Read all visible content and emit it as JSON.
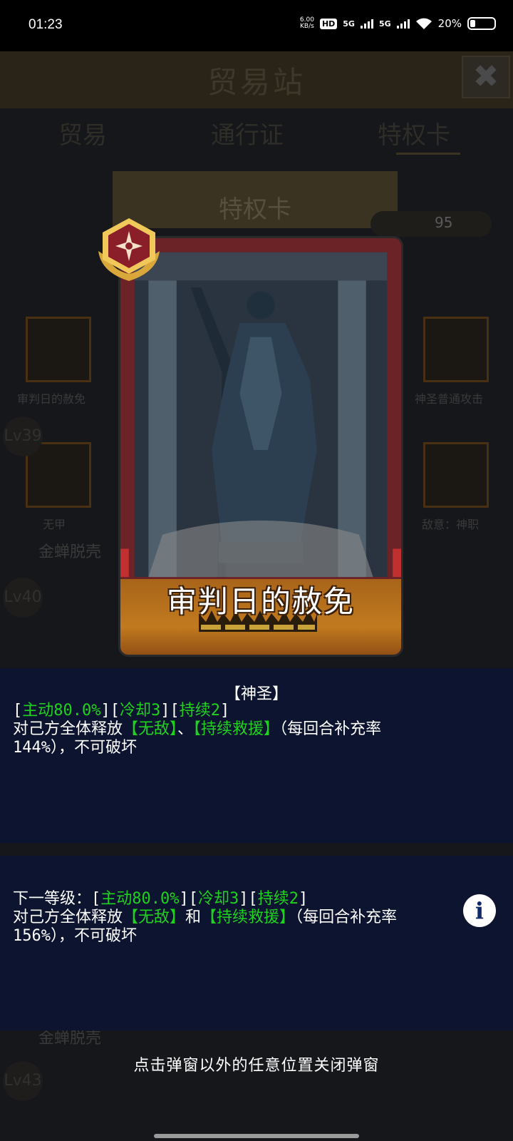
{
  "status_bar": {
    "time": "01:23",
    "net_speed_top": "6.00",
    "net_speed_unit": "KB/s",
    "hd_label": "HD",
    "sim1_label": "5G",
    "sim2_label": "5G",
    "battery": "20%"
  },
  "background": {
    "title": "贸易站",
    "tabs": [
      "贸易",
      "通行证",
      "特权卡"
    ],
    "section_title": "特权卡",
    "currency_value": "95",
    "left_items": [
      "审判日的赦免",
      "无甲"
    ],
    "right_items": [
      "神圣普通攻击",
      "敌意：神职"
    ],
    "levels": [
      "Lv39",
      "Lv40",
      "Lv43"
    ],
    "sub_labels": [
      "金蝉脱壳",
      "金蝉脱壳"
    ]
  },
  "card": {
    "name": "审判日的赦免",
    "crowns": 5
  },
  "popup": {
    "category": "【神圣】",
    "current": {
      "tags": [
        "[主动80.0%]",
        "[冷却3]",
        "[持续2]"
      ],
      "line_a": "对己方全体释放",
      "effect1": "【无敌】",
      "sep": "、",
      "effect2": "【持续救援】",
      "line_b": "（每回合补充率",
      "line_c": "144%），不可破坏"
    },
    "next": {
      "prefix": "下一等级：",
      "tags": [
        "[主动80.0%]",
        "[冷却3]",
        "[持续2]"
      ],
      "line_a": "对己方全体释放",
      "effect1": "【无敌】",
      "sep": "和",
      "effect2": "【持续救援】",
      "line_b": "（每回合补充率",
      "line_c": "156%），不可破坏"
    },
    "info_icon": "i",
    "close_hint": "点击弹窗以外的任意位置关闭弹窗"
  },
  "colors": {
    "highlight": "#1fd21f",
    "panel": "#0c1430",
    "card_banner": "#c17a1e"
  }
}
